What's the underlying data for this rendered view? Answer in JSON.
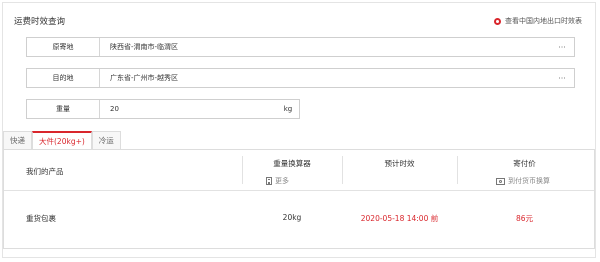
{
  "header": {
    "title": "运费时效查询",
    "link_label": "查看中国内地出口时效表"
  },
  "form": {
    "origin": {
      "label": "原寄地",
      "value": "陕西省-渭南市-临渭区",
      "more": "···"
    },
    "destination": {
      "label": "目的地",
      "value": "广东省-广州市-越秀区",
      "more": "···"
    },
    "weight": {
      "label": "重量",
      "value": "20",
      "unit": "kg"
    }
  },
  "tabs": [
    {
      "label": "快递",
      "active": false
    },
    {
      "label": "大件(20kg+)",
      "active": true
    },
    {
      "label": "冷运",
      "active": false
    }
  ],
  "table": {
    "headers": {
      "product": "我们的产品",
      "weight_calc": "重量换算器",
      "weight_calc_sub": "更多",
      "eta": "预计时效",
      "price": "寄付价",
      "price_sub": "到付货币换算"
    },
    "rows": [
      {
        "product": "重货包裹",
        "weight": "20kg",
        "eta": "2020-05-18 14:00 前",
        "price": "86元"
      }
    ]
  },
  "colors": {
    "accent": "#d9262c",
    "border": "#cfcfcf"
  }
}
